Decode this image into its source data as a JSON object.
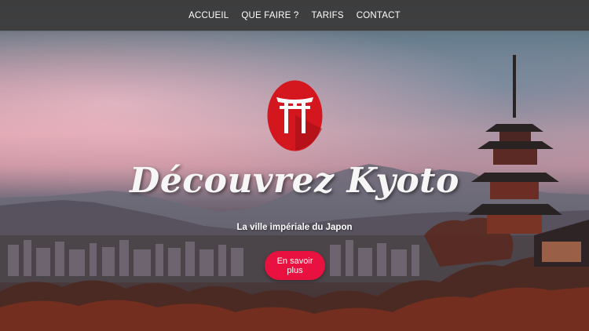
{
  "nav": {
    "items": [
      {
        "label": "ACCUEIL"
      },
      {
        "label": "QUE FAIRE ?"
      },
      {
        "label": "TARIFS"
      },
      {
        "label": "CONTACT"
      }
    ]
  },
  "hero": {
    "title": "Découvrez Kyoto",
    "subtitle": "La ville impériale du Japon",
    "cta_label": "En savoir plus"
  },
  "colors": {
    "nav_bg": "#3c3c3c",
    "cta": "#e8113f",
    "logo_bg": "#d4161f"
  },
  "icons": {
    "logo": "torii-gate-icon"
  }
}
